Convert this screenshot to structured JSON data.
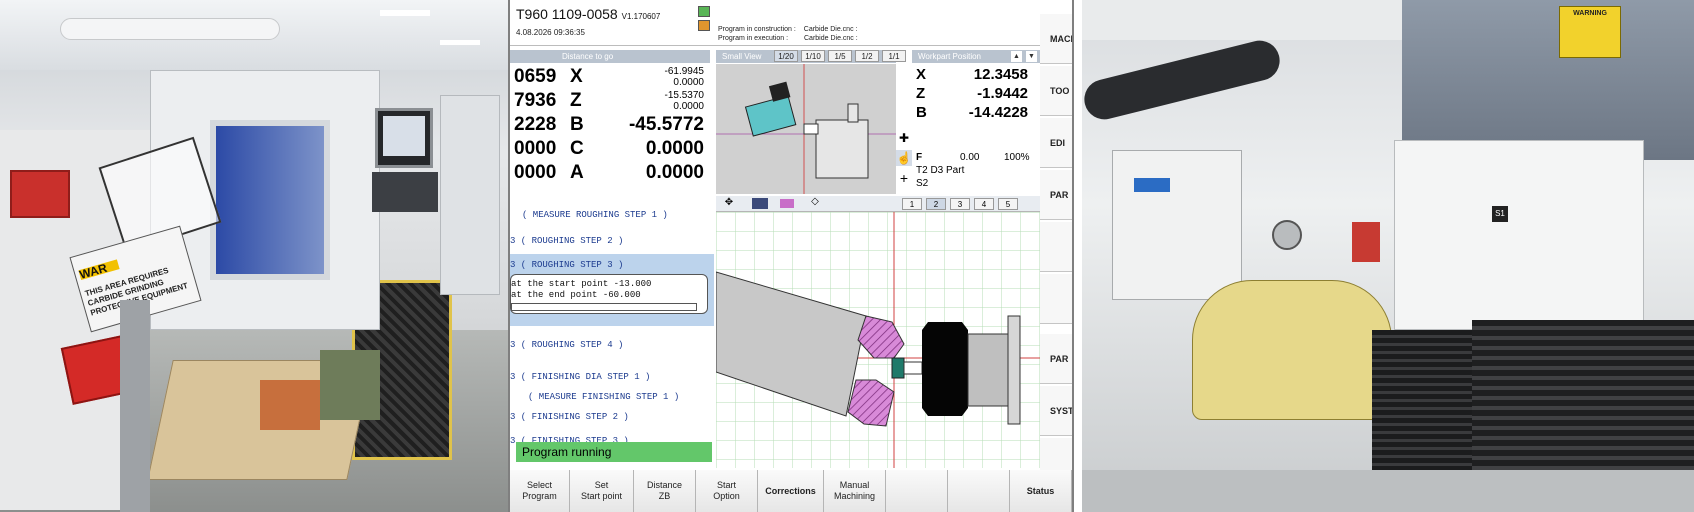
{
  "header": {
    "machine_id": "T960   1109-0058",
    "version": "V1.170607",
    "datetime": "4.08.2026    09:36:35",
    "program_construction_label": "Program in construction :",
    "program_construction_value": "Carbide Die.cnc :",
    "program_execution_label": "Program in execution :",
    "program_execution_value": "Carbide Die.cnc :"
  },
  "distance_panel": {
    "title": "Distance to go",
    "cut_values": [
      "0659",
      "7936",
      "2228",
      "0000",
      "0000"
    ],
    "rows": [
      {
        "axis": "X",
        "small1": "-61.9945",
        "small2": "0.0000",
        "big": ""
      },
      {
        "axis": "Z",
        "small1": "-15.5370",
        "small2": "0.0000",
        "big": ""
      },
      {
        "axis": "B",
        "small1": "",
        "small2": "",
        "big": "-45.5772"
      },
      {
        "axis": "C",
        "small1": "",
        "small2": "",
        "big": "0.0000"
      },
      {
        "axis": "A",
        "small1": "",
        "small2": "",
        "big": "0.0000"
      }
    ]
  },
  "small_view": {
    "title": "Small View",
    "tabs": [
      "1/20",
      "1/10",
      "1/5",
      "1/2",
      "1/1"
    ],
    "selected_tab": "1/20"
  },
  "workpart": {
    "title": "Workpart Position",
    "rows": [
      {
        "axis": "X",
        "value": "12.3458"
      },
      {
        "axis": "Z",
        "value": "-1.9442"
      },
      {
        "axis": "B",
        "value": "-14.4228"
      }
    ],
    "feed_label": "F",
    "feed_value": "0.00",
    "feed_percent": "100%",
    "tool_line": "T2 D3   Part",
    "spindle": "S2"
  },
  "big_view": {
    "tabs": [
      "1",
      "2",
      "3",
      "4",
      "5"
    ],
    "selected_tab": "2"
  },
  "program": {
    "lines": [
      "( MEASURE ROUGHING STEP 1 )",
      "3   ( ROUGHING STEP 2 )",
      "3   ( ROUGHING STEP 3 )",
      "3   ( ROUGHING STEP 4 )",
      "3   ( FINISHING DIA STEP 1 )",
      "( MEASURE FINISHING STEP 1 )",
      "3   ( FINISHING STEP 2 )",
      "3   ( FINISHING STEP 3 )"
    ],
    "dialog_line1": "at the start point -13.000",
    "dialog_line2": "at the end point -60.000",
    "status": "Program running"
  },
  "side_keys": [
    "MACI",
    "TOO",
    "EDI",
    "PAR",
    "",
    "",
    "PAR",
    "SYST",
    ""
  ],
  "softkeys": [
    {
      "line1": "Select",
      "line2": "Program"
    },
    {
      "line1": "Set",
      "line2": "Start point"
    },
    {
      "line1": "Distance",
      "line2": "ZB"
    },
    {
      "line1": "Start",
      "line2": "Option"
    },
    {
      "line1": "Corrections",
      "line2": ""
    },
    {
      "line1": "Manual",
      "line2": "Machining"
    },
    {
      "line1": "",
      "line2": ""
    },
    {
      "line1": "",
      "line2": ""
    },
    {
      "line1": "Status",
      "line2": ""
    }
  ],
  "photo_left_signs": {
    "warning": "WAR",
    "caution": "THIS AREA REQUIRES\nCARBIDE GRINDING\nPROTECTIVE EQUIPMENT"
  },
  "photo_right_signs": {
    "warning": "WARNING",
    "plate": "S1"
  },
  "colors": {
    "panel_title": "#b9c3cf",
    "program_text": "#1c3b8f",
    "status_green": "#63c76a",
    "tool_cyan": "#5ec4c8",
    "cut_magenta": "#c86ec8"
  }
}
